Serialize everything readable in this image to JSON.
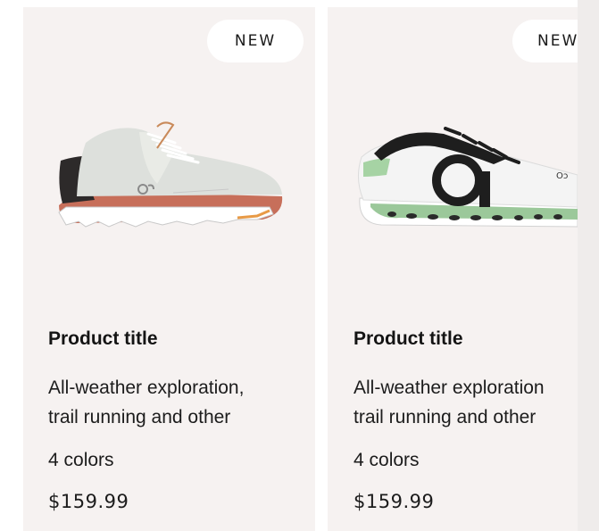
{
  "products": [
    {
      "badge": "NEW",
      "title": "Product title",
      "description_line1": "All-weather exploration,",
      "description_line2": "trail running and other",
      "colors": "4 colors",
      "price": "$159.99",
      "image": "running-shoe-grey-rust"
    },
    {
      "badge": "NEW",
      "title": "Product title",
      "description_line1": "All-weather exploration",
      "description_line2": "trail running and other",
      "colors": "4 colors",
      "price": "$159.99",
      "image": "running-shoe-white-black-green"
    }
  ],
  "colors": {
    "card_background": "#f6f2f1",
    "badge_background": "#ffffff",
    "text": "#1c1c1c"
  }
}
